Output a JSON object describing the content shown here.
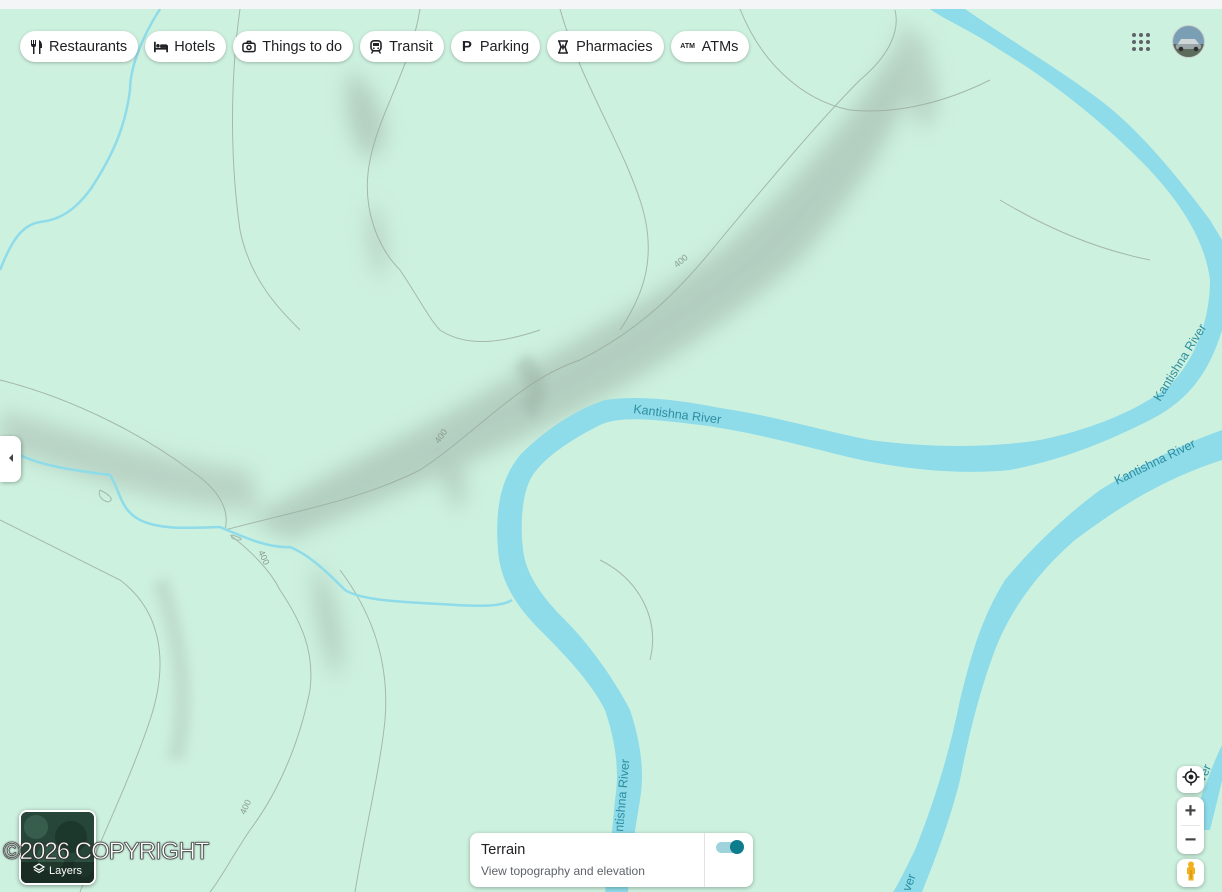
{
  "chips": [
    {
      "label": "Restaurants",
      "icon": "fork-knife-icon"
    },
    {
      "label": "Hotels",
      "icon": "bed-icon"
    },
    {
      "label": "Things to do",
      "icon": "camera-icon"
    },
    {
      "label": "Transit",
      "icon": "train-icon"
    },
    {
      "label": "Parking",
      "icon": "parking-icon"
    },
    {
      "label": "Pharmacies",
      "icon": "pharmacy-icon"
    },
    {
      "label": "ATMs",
      "icon": "atm-icon"
    }
  ],
  "map": {
    "river_labels": [
      "Kantishna River",
      "Kantishna River",
      "Kantishna River",
      "ntishna River",
      "iver",
      "ver"
    ],
    "contour_labels": [
      "400",
      "400",
      "400",
      "400"
    ],
    "colors": {
      "land": "#cdf1df",
      "water": "#8edbe9",
      "river_text": "#2d8ea0",
      "contour": "#9aaa9f"
    }
  },
  "layers": {
    "label": "Layers"
  },
  "watermark": "©2026 COPYRIGHT",
  "terrain": {
    "title": "Terrain",
    "subtitle": "View topography and elevation",
    "enabled": true
  },
  "icons": [
    "apps-grid-icon",
    "avatar",
    "chevron-left-icon",
    "my-location-icon",
    "pegman-icon",
    "layers-icon"
  ]
}
